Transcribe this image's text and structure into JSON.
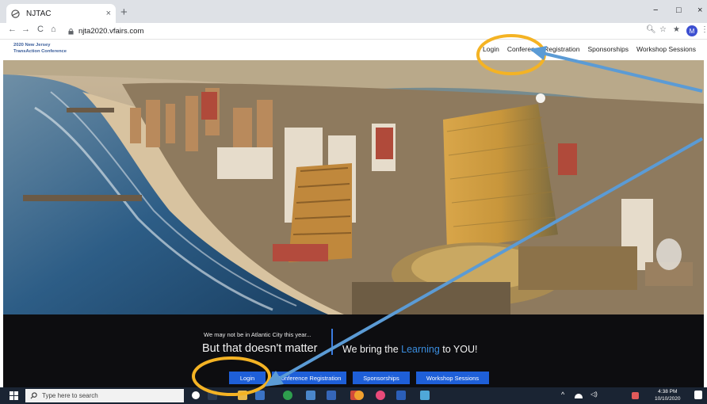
{
  "browser": {
    "tab_title": "NJTAC",
    "tab_close": "×",
    "new_tab": "+",
    "window_controls": [
      "−",
      "□",
      "×"
    ],
    "url": "njta2020.vfairs.com",
    "nav_icons": [
      "back-icon",
      "forward-icon",
      "reload-icon",
      "home-icon"
    ],
    "profile_initial": "M"
  },
  "site": {
    "logo_line1": "2020 New Jersey",
    "logo_line2": "TransAction Conference",
    "nav": {
      "login": "Login",
      "conference_registration": "Conference Registration",
      "sponsorships": "Sponsorships",
      "workshop_sessions": "Workshop Sessions"
    }
  },
  "hero_band": {
    "tagline_small": "We may not be in Atlantic City this year...",
    "tagline_big": "But that doesn't matter",
    "tagline_right_pre": "We bring the ",
    "tagline_right_highlight": "Learning",
    "tagline_right_post": " to YOU!",
    "buttons": {
      "login": "Login",
      "conference_registration": "Conference Registration",
      "sponsorships": "Sponsorships",
      "workshop_sessions": "Workshop Sessions"
    }
  },
  "taskbar": {
    "search_placeholder": "Type here to search",
    "time": "4:38 PM",
    "date": "10/10/2020"
  },
  "colors": {
    "accent_blue": "#1e5fd8",
    "annotation_circle": "#f4b324",
    "annotation_arrow": "#5b9bd5"
  }
}
